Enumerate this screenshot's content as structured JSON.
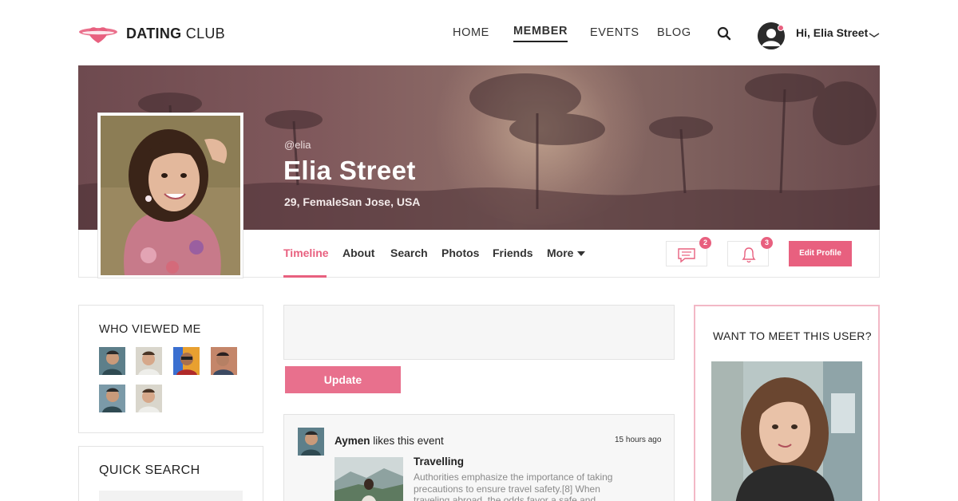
{
  "brand": {
    "name_bold": "DATING",
    "name_regular": " CLUB",
    "accent": "#e8607f"
  },
  "nav": {
    "items": [
      {
        "label": "HOME"
      },
      {
        "label": "MEMBER",
        "active": true
      },
      {
        "label": "EVENTS"
      },
      {
        "label": "BLOG"
      }
    ],
    "search_icon": "search-icon",
    "greeting": "Hi, Elia Street"
  },
  "profile": {
    "handle": "@elia",
    "name": "Elia Street",
    "meta": "29, FemaleSan Jose, USA"
  },
  "tabs": [
    {
      "label": "Timeline",
      "active": true
    },
    {
      "label": "About"
    },
    {
      "label": "Search"
    },
    {
      "label": "Photos"
    },
    {
      "label": "Friends"
    },
    {
      "label": "More"
    }
  ],
  "actions": {
    "messages_count": "2",
    "notifications_count": "3",
    "edit_profile": "Edit Profile"
  },
  "who_viewed": {
    "title": "WHO VIEWED ME",
    "viewer_count": 6
  },
  "quick_search": {
    "title": "QUICK SEARCH"
  },
  "composer": {
    "update_label": "Update"
  },
  "feed": {
    "user": "Aymen",
    "action": " likes this event",
    "time": "15 hours ago",
    "event_title": "Travelling",
    "event_desc": "Authorities emphasize the importance of taking precautions to ensure travel safety.[8] When traveling abroad, the odds favor a safe and"
  },
  "meet": {
    "title": "WANT TO MEET THIS USER?"
  }
}
